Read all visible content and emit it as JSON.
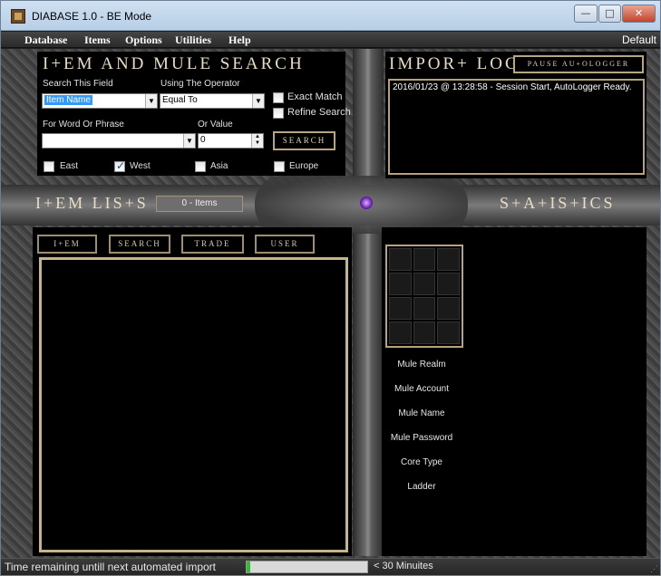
{
  "window": {
    "title": "DIABASE 1.0 - BE Mode"
  },
  "menu": {
    "items": [
      "Database",
      "Items",
      "Options",
      "Utilities",
      "Help"
    ],
    "profile": "Default"
  },
  "search": {
    "heading": "I+EM AND MULE SEARCH",
    "field_label": "Search This Field",
    "field_value": "Item Name",
    "operator_label": "Using The Operator",
    "operator_value": "Equal To",
    "exact_match": "Exact Match",
    "refine_search": "Refine Search",
    "word_label": "For Word Or Phrase",
    "value_label": "Or Value",
    "value": "0",
    "search_button": "SEARCH",
    "realms": [
      {
        "label": "East",
        "checked": false
      },
      {
        "label": "West",
        "checked": true
      },
      {
        "label": "Asia",
        "checked": false
      },
      {
        "label": "Europe",
        "checked": false
      }
    ]
  },
  "import_log": {
    "heading": "IMPOR+ LOG",
    "pause_button": "PAUSE AU+OLOGGER",
    "lines": [
      "2016/01/23 @ 13:28:58 - Session Start, AutoLogger Ready."
    ]
  },
  "item_lists": {
    "heading": "I+EM LIS+S",
    "count_badge": "0 - Items",
    "tabs": [
      "I+EM",
      "SEARCH",
      "TRADE",
      "USER"
    ]
  },
  "statistics": {
    "heading": "S+A+IS+ICS",
    "labels": [
      "Mule Realm",
      "Mule Account",
      "Mule Name",
      "Mule Password",
      "Core Type",
      "Ladder"
    ]
  },
  "status": {
    "left": "Time remaining untill next automated import",
    "right": "< 30 Minuites",
    "progress": 0.03
  },
  "colors": {
    "accent": "#c8b48a",
    "progress": "#2ec02e"
  }
}
